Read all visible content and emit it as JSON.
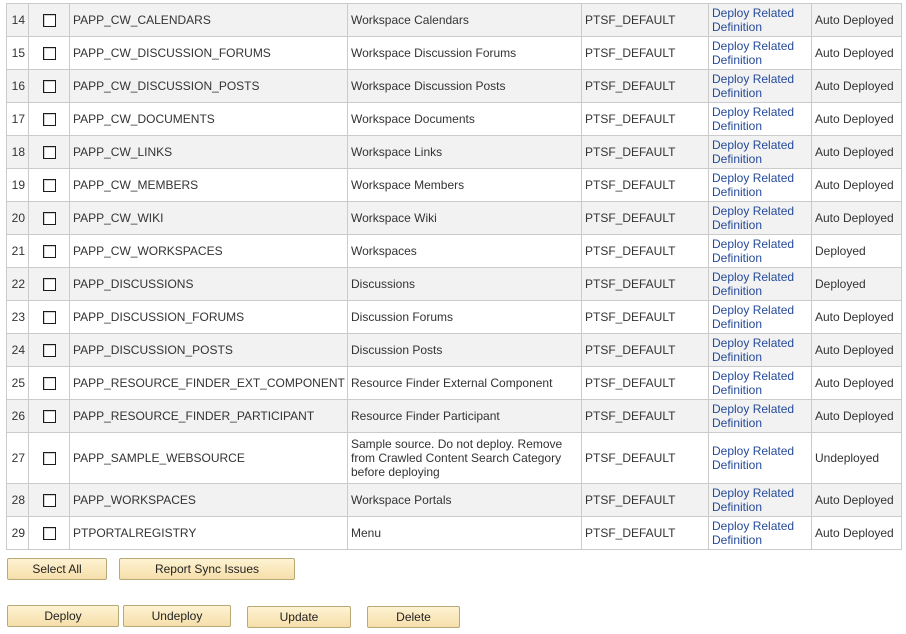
{
  "grid": {
    "link_label": "Deploy Related Definition",
    "rows": [
      {
        "num": "14",
        "name": "PAPP_CW_CALENDARS",
        "description": "Workspace Calendars",
        "node": "PTSF_DEFAULT",
        "status": "Auto Deployed"
      },
      {
        "num": "15",
        "name": "PAPP_CW_DISCUSSION_FORUMS",
        "description": "Workspace Discussion Forums",
        "node": "PTSF_DEFAULT",
        "status": "Auto Deployed"
      },
      {
        "num": "16",
        "name": "PAPP_CW_DISCUSSION_POSTS",
        "description": "Workspace Discussion Posts",
        "node": "PTSF_DEFAULT",
        "status": "Auto Deployed"
      },
      {
        "num": "17",
        "name": "PAPP_CW_DOCUMENTS",
        "description": "Workspace Documents",
        "node": "PTSF_DEFAULT",
        "status": "Auto Deployed"
      },
      {
        "num": "18",
        "name": "PAPP_CW_LINKS",
        "description": "Workspace Links",
        "node": "PTSF_DEFAULT",
        "status": "Auto Deployed"
      },
      {
        "num": "19",
        "name": "PAPP_CW_MEMBERS",
        "description": "Workspace Members",
        "node": "PTSF_DEFAULT",
        "status": "Auto Deployed"
      },
      {
        "num": "20",
        "name": "PAPP_CW_WIKI",
        "description": "Workspace Wiki",
        "node": "PTSF_DEFAULT",
        "status": "Auto Deployed"
      },
      {
        "num": "21",
        "name": "PAPP_CW_WORKSPACES",
        "description": "Workspaces",
        "node": "PTSF_DEFAULT",
        "status": "Deployed"
      },
      {
        "num": "22",
        "name": "PAPP_DISCUSSIONS",
        "description": "Discussions",
        "node": "PTSF_DEFAULT",
        "status": "Deployed"
      },
      {
        "num": "23",
        "name": "PAPP_DISCUSSION_FORUMS",
        "description": "Discussion Forums",
        "node": "PTSF_DEFAULT",
        "status": "Auto Deployed"
      },
      {
        "num": "24",
        "name": "PAPP_DISCUSSION_POSTS",
        "description": "Discussion Posts",
        "node": "PTSF_DEFAULT",
        "status": "Auto Deployed"
      },
      {
        "num": "25",
        "name": "PAPP_RESOURCE_FINDER_EXT_COMPONENT",
        "description": "Resource Finder External Component",
        "node": "PTSF_DEFAULT",
        "status": "Auto Deployed"
      },
      {
        "num": "26",
        "name": "PAPP_RESOURCE_FINDER_PARTICIPANT",
        "description": "Resource Finder Participant",
        "node": "PTSF_DEFAULT",
        "status": "Auto Deployed"
      },
      {
        "num": "27",
        "name": "PAPP_SAMPLE_WEBSOURCE",
        "description": "Sample source. Do not deploy. Remove from Crawled Content Search Category before deploying",
        "node": "PTSF_DEFAULT",
        "status": "Undeployed"
      },
      {
        "num": "28",
        "name": "PAPP_WORKSPACES",
        "description": "Workspace Portals",
        "node": "PTSF_DEFAULT",
        "status": "Auto Deployed"
      },
      {
        "num": "29",
        "name": "PTPORTALREGISTRY",
        "description": "Menu",
        "node": "PTSF_DEFAULT",
        "status": "Auto Deployed"
      }
    ]
  },
  "buttons": {
    "select_all": "Select All",
    "report_sync_issues": "Report Sync Issues",
    "deploy": "Deploy",
    "undeploy": "Undeploy",
    "update": "Update",
    "delete": "Delete"
  }
}
